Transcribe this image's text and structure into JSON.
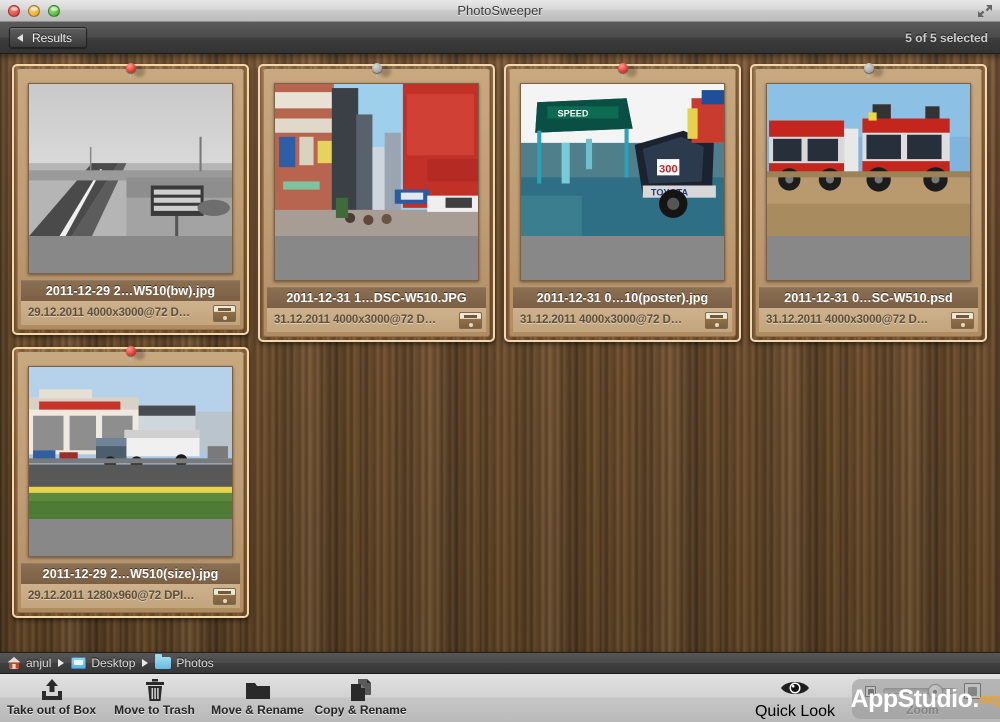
{
  "window": {
    "title": "PhotoSweeper",
    "traffic_lights": [
      "close",
      "minimize",
      "maximize"
    ],
    "fullscreen_icon": "fullscreen-arrows-icon"
  },
  "toolbar_top": {
    "back_label": "Results",
    "selection_status": "5 of 5 selected"
  },
  "cards": [
    {
      "filename": "2011-12-29 2…W510(bw).jpg",
      "date": "29.12.2011",
      "specs": "4000x3000@72 D…",
      "pin": "red",
      "selected": true,
      "box_icon": "box-icon"
    },
    {
      "filename": "2011-12-31 1…DSC-W510.JPG",
      "date": "31.12.2011",
      "specs": "4000x3000@72 D…",
      "pin": "grey",
      "selected": false,
      "box_icon": "box-icon"
    },
    {
      "filename": "2011-12-31 0…10(poster).jpg",
      "date": "31.12.2011",
      "specs": "4000x3000@72 D…",
      "pin": "red",
      "selected": false,
      "box_icon": "box-icon"
    },
    {
      "filename": "2011-12-31 0…SC-W510.psd",
      "date": "31.12.2011",
      "specs": "4000x3000@72 D…",
      "pin": "grey",
      "selected": false,
      "box_icon": "box-icon"
    },
    {
      "filename": "2011-12-29 2…W510(size).jpg",
      "date": "29.12.2011",
      "specs": "1280x960@72 DPI…",
      "pin": "red",
      "selected": true,
      "box_icon": "box-icon"
    }
  ],
  "breadcrumb": [
    {
      "label": "anjul",
      "icon": "home-icon"
    },
    {
      "label": "Desktop",
      "icon": "desktop-icon"
    },
    {
      "label": "Photos",
      "icon": "folder-icon"
    }
  ],
  "toolbar_bottom": {
    "buttons": [
      {
        "label": "Take out of Box",
        "icon": "take-out-of-box-icon"
      },
      {
        "label": "Move to Trash",
        "icon": "trash-icon"
      },
      {
        "label": "Move & Rename",
        "icon": "folder-move-icon"
      },
      {
        "label": "Copy & Rename",
        "icon": "copy-pages-icon"
      }
    ],
    "quick_look": {
      "label": "Quick Look",
      "icon": "eye-icon"
    },
    "zoom": {
      "label": "Zoom",
      "small_icon": "small-thumbnail-icon",
      "large_icon": "large-thumbnail-icon",
      "value": 60
    }
  },
  "watermark": {
    "text": "AppStudio.",
    "suffix": "org"
  },
  "colors": {
    "wood": "#7a5733",
    "card_frame": "#f0d9ae",
    "filename_bar": "#8a6f52",
    "meta_bar": "#c9ae88",
    "accent_orange": "#f5a020"
  }
}
